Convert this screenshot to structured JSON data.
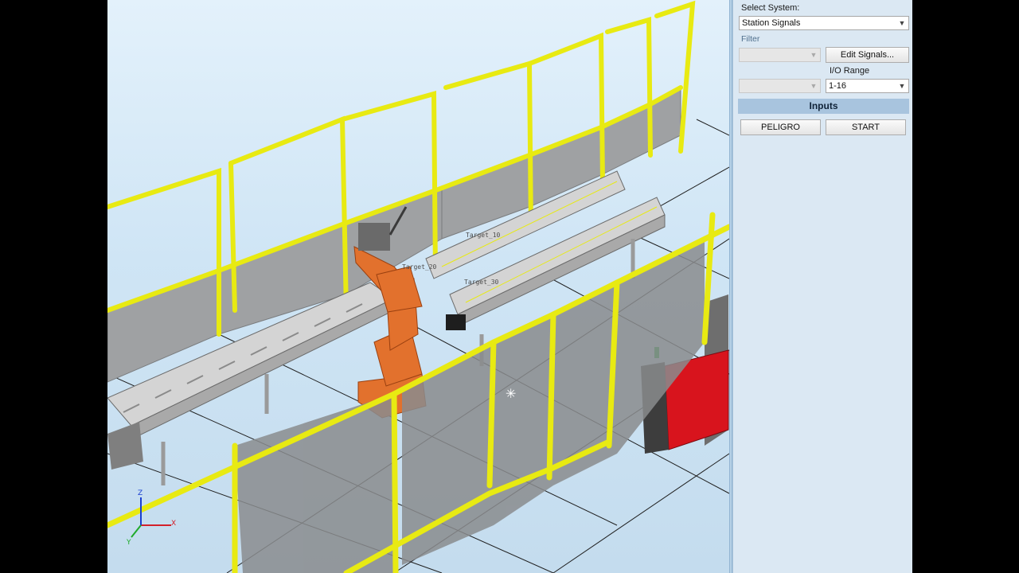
{
  "panel": {
    "select_system_label": "Select System:",
    "select_system_value": "Station Signals",
    "filter_label": "Filter",
    "filter_value": "",
    "edit_signals_label": "Edit Signals...",
    "io_range_label": "I/O Range",
    "io_range_left_value": "",
    "io_range_value": "1-16",
    "section_title": "Inputs",
    "inputs": [
      {
        "label": "PELIGRO"
      },
      {
        "label": "START"
      }
    ]
  },
  "viewport": {
    "target_labels": [
      "Target_10",
      "Target_20",
      "Target_30"
    ],
    "axis_labels": {
      "x": "X",
      "y": "Y",
      "z": "Z"
    },
    "colors": {
      "fence": "#e8ea12",
      "robot": "#e2712d",
      "cabinet": "#d8141d",
      "conveyor": "#c7c7c7",
      "panel_fill": "#9fa1a3"
    }
  }
}
